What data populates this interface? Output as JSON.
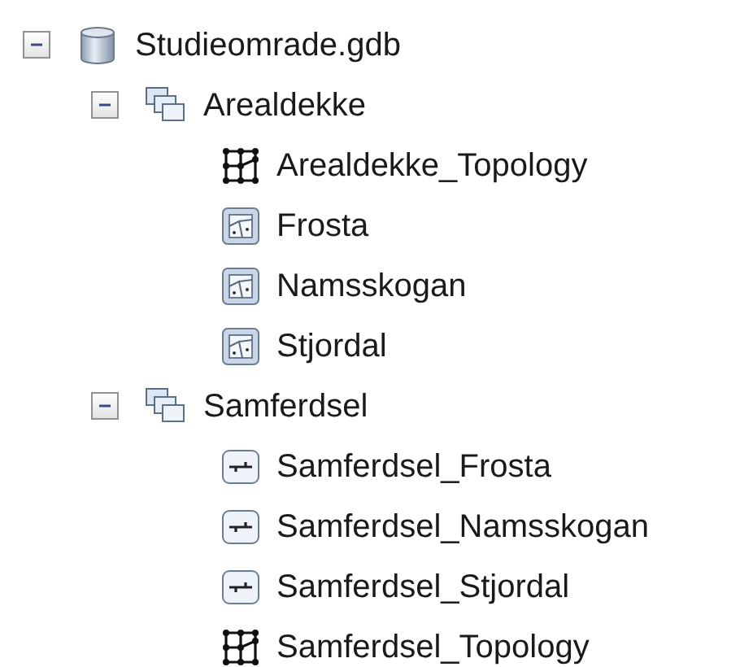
{
  "tree": [
    {
      "label": "Studieomrade.gdb",
      "kind": "database",
      "expanded": true,
      "children": [
        {
          "label": "Arealdekke",
          "kind": "dataset",
          "expanded": true,
          "children": [
            {
              "label": "Arealdekke_Topology",
              "kind": "topology"
            },
            {
              "label": "Frosta",
              "kind": "polygon"
            },
            {
              "label": "Namsskogan",
              "kind": "polygon"
            },
            {
              "label": "Stjordal",
              "kind": "polygon"
            }
          ]
        },
        {
          "label": "Samferdsel",
          "kind": "dataset",
          "expanded": true,
          "children": [
            {
              "label": "Samferdsel_Frosta",
              "kind": "line"
            },
            {
              "label": "Samferdsel_Namsskogan",
              "kind": "line"
            },
            {
              "label": "Samferdsel_Stjordal",
              "kind": "line"
            },
            {
              "label": "Samferdsel_Topology",
              "kind": "topology"
            }
          ]
        }
      ]
    }
  ]
}
